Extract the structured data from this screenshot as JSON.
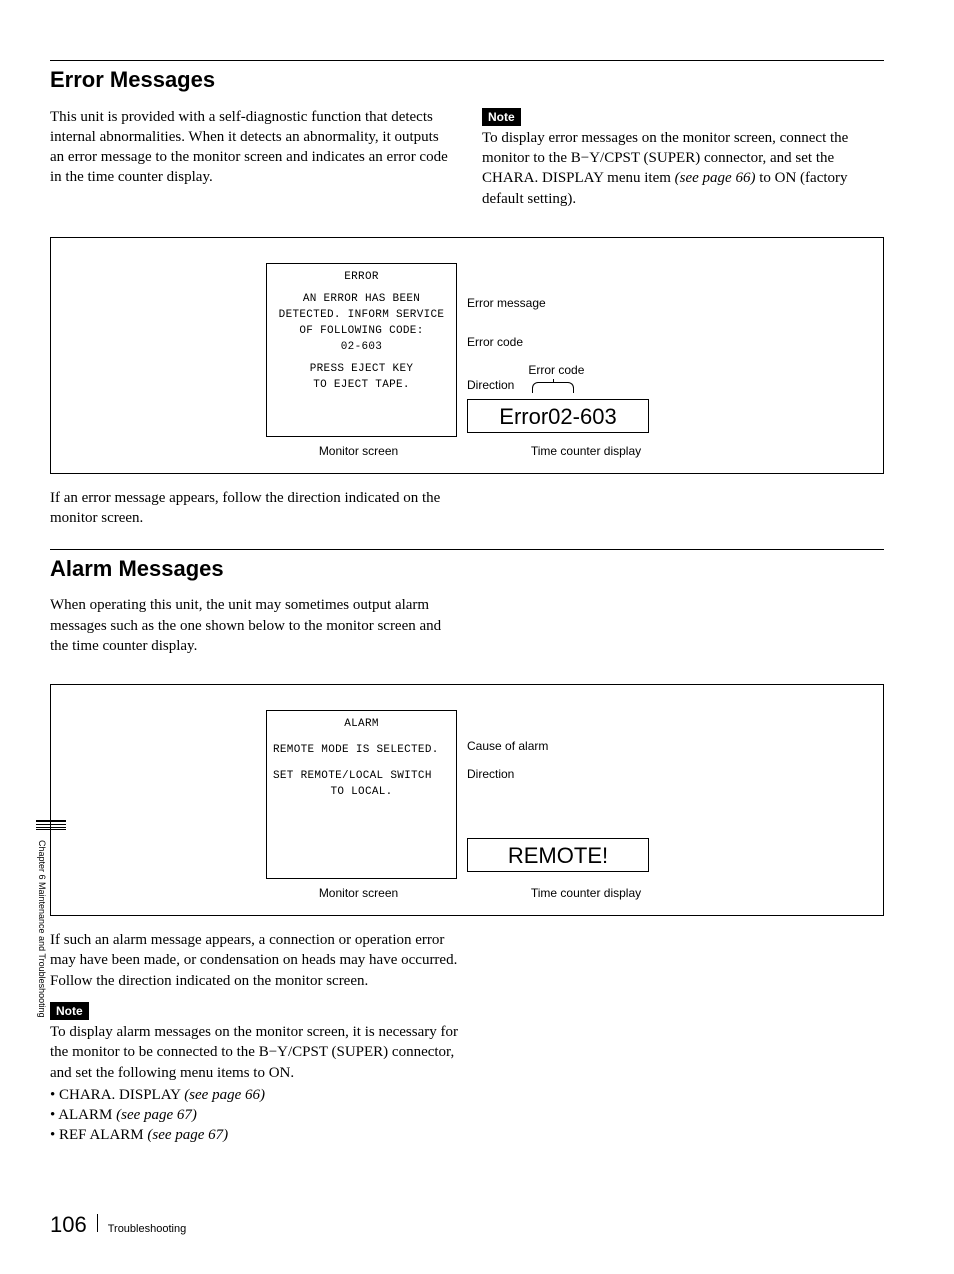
{
  "headings": {
    "error": "Error Messages",
    "alarm": "Alarm Messages"
  },
  "error_section": {
    "intro": "This unit is provided with a self-diagnostic function that detects internal abnormalities. When it detects an abnormality, it outputs an error message to the monitor screen and indicates an error code in the time counter display.",
    "note_label": "Note",
    "note_text_a": "To display error messages on the monitor screen, connect the monitor to the B−Y/CPST (SUPER) connector, and set the CHARA. DISPLAY menu item ",
    "note_ref": "(see page 66)",
    "note_text_b": " to ON (factory default setting).",
    "monitor": {
      "l1": "ERROR",
      "l2": "AN ERROR HAS BEEN",
      "l3": "DETECTED. INFORM SERVICE",
      "l4": "OF FOLLOWING CODE:",
      "l5": "02-603",
      "l6": "PRESS EJECT KEY",
      "l7": "TO EJECT TAPE."
    },
    "annotations": {
      "msg": "Error message",
      "code": "Error code",
      "direction": "Direction",
      "code2": "Error code"
    },
    "counter": "Error02-603",
    "labels": {
      "monitor": "Monitor screen",
      "counter": "Time counter display"
    },
    "outro": "If an error message appears, follow the direction indicated on the monitor screen."
  },
  "alarm_section": {
    "intro": "When operating this unit, the unit may sometimes output alarm messages such as the one shown below to the monitor screen and the time counter display.",
    "monitor": {
      "l1": "ALARM",
      "l2": "REMOTE MODE IS SELECTED.",
      "l3": "SET REMOTE/LOCAL SWITCH",
      "l4": "TO LOCAL."
    },
    "annotations": {
      "cause": "Cause of alarm",
      "direction": "Direction"
    },
    "counter": "REMOTE!",
    "labels": {
      "monitor": "Monitor screen",
      "counter": "Time counter display"
    },
    "outro": "If such an alarm message appears, a connection or operation error may have been made, or condensation on heads may have occurred. Follow the direction indicated on the monitor screen.",
    "note_label": "Note",
    "note_text": "To display alarm messages on the monitor screen, it is necessary for the monitor to be connected to the B−Y/CPST (SUPER) connector, and set the following menu items to ON.",
    "bullets": {
      "b1_a": "CHARA. DISPLAY ",
      "b1_b": "(see page 66)",
      "b2_a": "ALARM ",
      "b2_b": "(see page 67)",
      "b3_a": "REF ALARM ",
      "b3_b": "(see page 67)"
    }
  },
  "side_text": "Chapter 6   Maintenance and Troubleshooting",
  "footer": {
    "page": "106",
    "section": "Troubleshooting"
  }
}
